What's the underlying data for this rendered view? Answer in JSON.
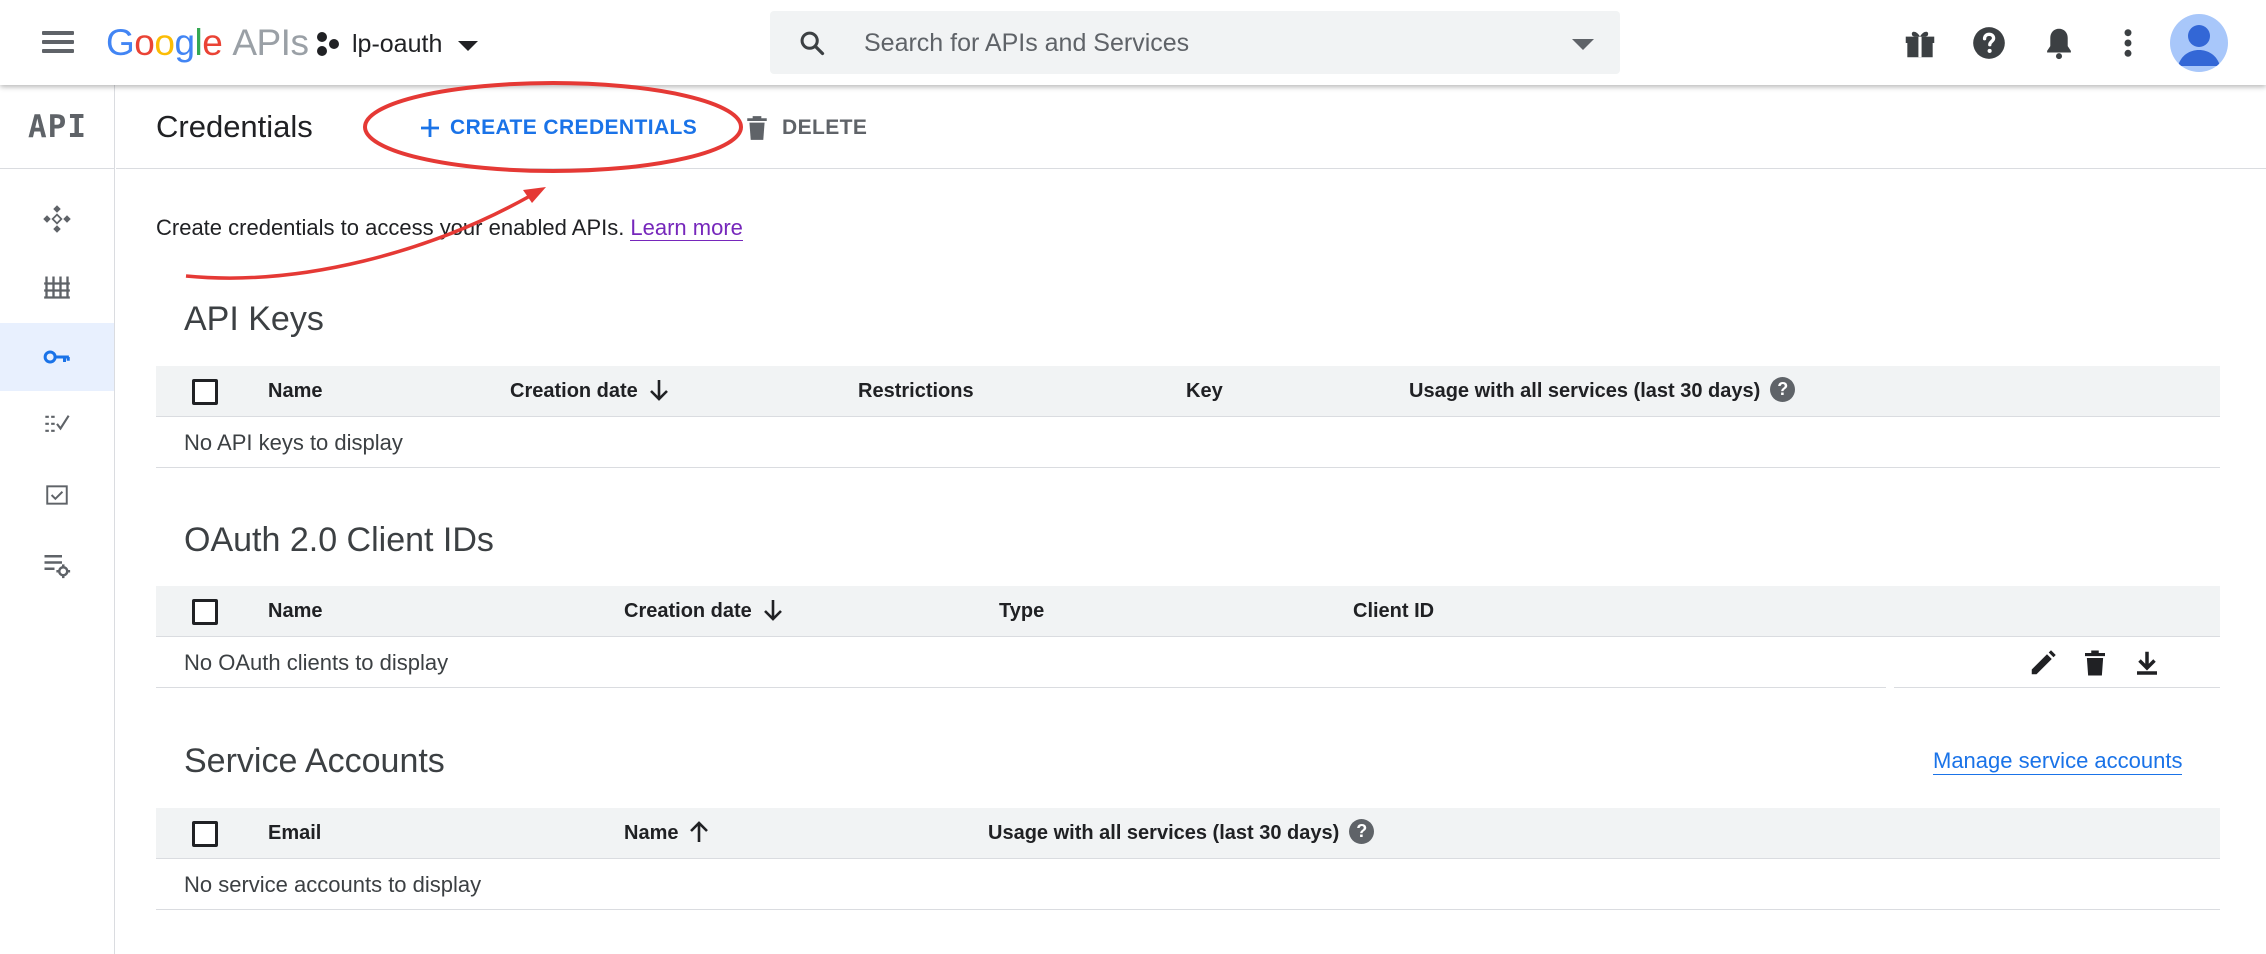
{
  "topbar": {
    "logo_google": "Google",
    "logo_apis": "APIs",
    "project_name": "lp-oauth",
    "search_placeholder": "Search for APIs and Services"
  },
  "sidebar": {
    "logo_text": "API",
    "items": [
      "dashboard",
      "library",
      "credentials",
      "oauth-consent",
      "domain-verification",
      "page-usage-agreements"
    ]
  },
  "header": {
    "title": "Credentials",
    "create_label": "CREATE CREDENTIALS",
    "delete_label": "DELETE"
  },
  "intro": {
    "text": "Create credentials to access your enabled APIs.",
    "learn_more": "Learn more"
  },
  "api_keys": {
    "title": "API Keys",
    "columns": [
      "Name",
      "Creation date",
      "Restrictions",
      "Key",
      "Usage with all services (last 30 days)"
    ],
    "empty": "No API keys to display"
  },
  "oauth_clients": {
    "title": "OAuth 2.0 Client IDs",
    "columns": [
      "Name",
      "Creation date",
      "Type",
      "Client ID"
    ],
    "empty": "No OAuth clients to display"
  },
  "service_accounts": {
    "title": "Service Accounts",
    "manage_link": "Manage service accounts",
    "columns": [
      "Email",
      "Name",
      "Usage with all services (last 30 days)"
    ],
    "empty": "No service accounts to display"
  },
  "colors": {
    "accent_blue": "#1a73e8",
    "annotation_red": "#e53935",
    "active_sidebar": "#e8f0fe"
  }
}
